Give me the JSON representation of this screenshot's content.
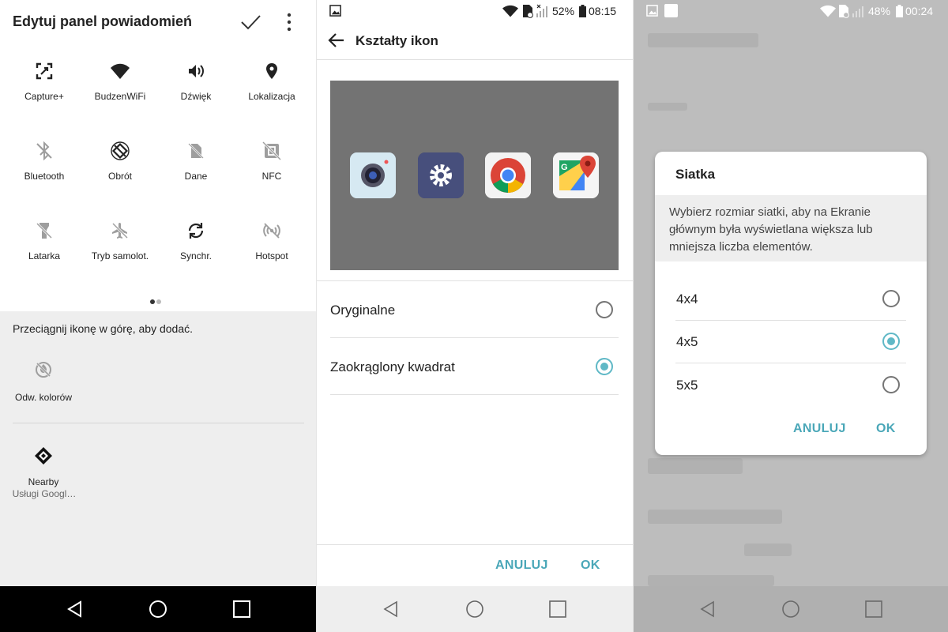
{
  "panel1": {
    "title": "Edytuj panel powiadomień",
    "tiles": [
      {
        "label": "Capture+",
        "icon": "capture-plus-icon"
      },
      {
        "label": "BudzenWiFi",
        "icon": "wifi-icon"
      },
      {
        "label": "Dźwięk",
        "icon": "sound-icon"
      },
      {
        "label": "Lokalizacja",
        "icon": "location-icon"
      },
      {
        "label": "Bluetooth",
        "icon": "bluetooth-off-icon"
      },
      {
        "label": "Obrót",
        "icon": "rotation-icon"
      },
      {
        "label": "Dane",
        "icon": "data-off-icon"
      },
      {
        "label": "NFC",
        "icon": "nfc-off-icon"
      },
      {
        "label": "Latarka",
        "icon": "flashlight-off-icon"
      },
      {
        "label": "Tryb samolot.",
        "icon": "airplane-off-icon"
      },
      {
        "label": "Synchr.",
        "icon": "sync-icon"
      },
      {
        "label": "Hotspot",
        "icon": "hotspot-off-icon"
      }
    ],
    "tray_hint": "Przeciągnij ikonę w górę, aby dodać.",
    "tray_items": [
      {
        "label": "Odw. kolorów",
        "icon": "invert-colors-icon"
      },
      {
        "label": "Nearby",
        "sublabel": "Usługi Googl…",
        "icon": "nearby-icon"
      }
    ]
  },
  "panel2": {
    "status": {
      "battery": "52%",
      "time": "08:15"
    },
    "title": "Kształty ikon",
    "preview_icons": [
      "camera-app-icon",
      "settings-app-icon",
      "chrome-app-icon",
      "maps-app-icon"
    ],
    "options": [
      {
        "label": "Oryginalne",
        "selected": false
      },
      {
        "label": "Zaokrąglony kwadrat",
        "selected": true
      }
    ],
    "cancel_label": "ANULUJ",
    "ok_label": "OK"
  },
  "panel3": {
    "status": {
      "battery": "48%",
      "time": "00:24"
    },
    "dialog": {
      "title": "Siatka",
      "description": "Wybierz rozmiar siatki, aby na Ekranie głównym była wyświetlana większa lub mniejsza liczba elementów.",
      "options": [
        {
          "label": "4x4",
          "selected": false
        },
        {
          "label": "4x5",
          "selected": true
        },
        {
          "label": "5x5",
          "selected": false
        }
      ],
      "cancel_label": "ANULUJ",
      "ok_label": "OK"
    }
  },
  "colors": {
    "accent": "#4aa7b8",
    "radio_selected": "#5fb8c6",
    "preview_bg": "#737373"
  }
}
